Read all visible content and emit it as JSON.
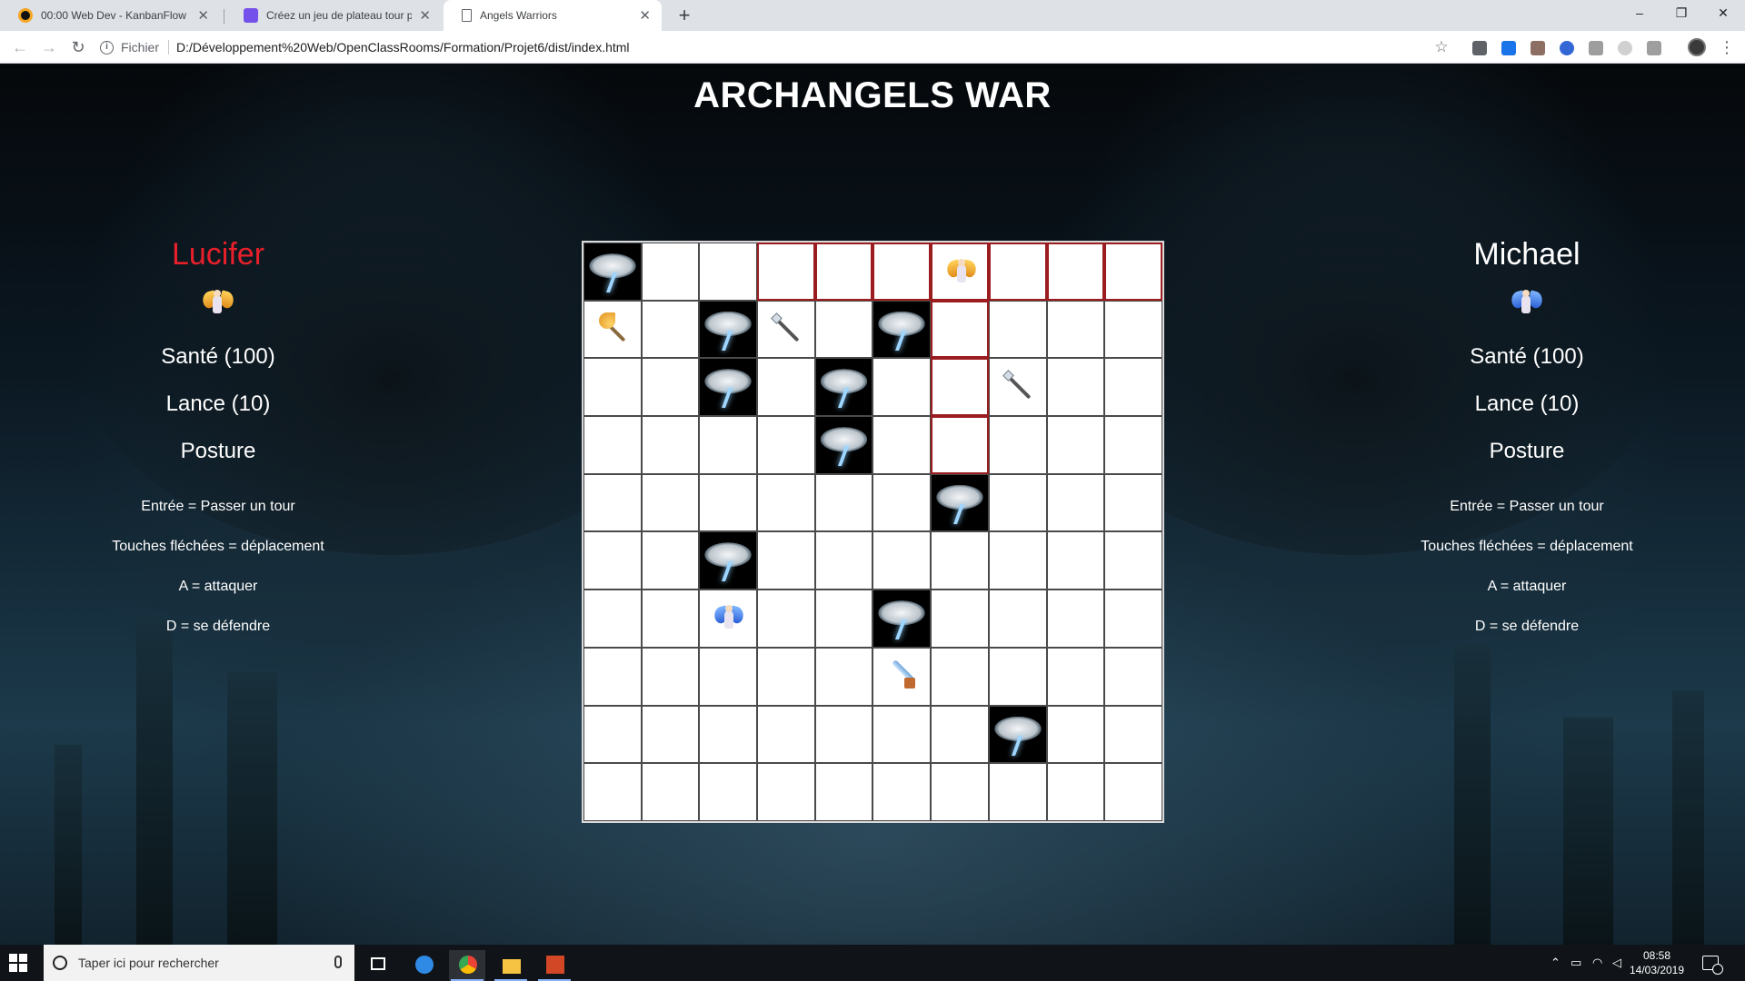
{
  "browser": {
    "tabs": [
      {
        "title": "00:00 Web Dev - KanbanFlow",
        "favicon_color": "#f5a623"
      },
      {
        "title": "Créez un jeu de plateau tour par",
        "favicon_color": "#7451eb"
      },
      {
        "title": "Angels Warriors",
        "favicon_color": "#ffffff"
      }
    ],
    "active_tab": 2,
    "address": {
      "scheme": "Fichier",
      "url": "D:/Développement%20Web/OpenClassRooms/Formation/Projet6/dist/index.html"
    }
  },
  "game": {
    "title": "ARCHANGELS WAR",
    "players": [
      {
        "name": "Lucifer",
        "name_color": "#e8202b",
        "avatar": "gold-angel-icon",
        "health": "Santé (100)",
        "weapon": "Lance (10)",
        "stance": "Posture",
        "controls": [
          "Entrée = Passer un tour",
          "Touches fléchées = déplacement",
          "A = attaquer",
          "D = se défendre"
        ]
      },
      {
        "name": "Michael",
        "name_color": "#ffffff",
        "avatar": "blue-angel-icon",
        "health": "Santé (100)",
        "weapon": "Lance (10)",
        "stance": "Posture",
        "controls": [
          "Entrée = Passer un tour",
          "Touches fléchées = déplacement",
          "A = attaquer",
          "D = se défendre"
        ]
      }
    ],
    "board": {
      "rows": 10,
      "cols": 10,
      "obstacles": [
        [
          0,
          0
        ],
        [
          1,
          2
        ],
        [
          1,
          5
        ],
        [
          2,
          2
        ],
        [
          2,
          4
        ],
        [
          3,
          4
        ],
        [
          4,
          6
        ],
        [
          5,
          2
        ],
        [
          6,
          5
        ],
        [
          8,
          7
        ]
      ],
      "highlights": [
        [
          0,
          3
        ],
        [
          0,
          4
        ],
        [
          0,
          5
        ],
        [
          0,
          6
        ],
        [
          0,
          7
        ],
        [
          0,
          8
        ],
        [
          0,
          9
        ],
        [
          1,
          6
        ],
        [
          2,
          6
        ],
        [
          3,
          6
        ]
      ],
      "pieces": [
        {
          "row": 0,
          "col": 6,
          "kind": "gold-angel-icon"
        },
        {
          "row": 6,
          "col": 2,
          "kind": "blue-angel-icon"
        },
        {
          "row": 1,
          "col": 0,
          "kind": "axe-icon"
        },
        {
          "row": 1,
          "col": 3,
          "kind": "spear-icon"
        },
        {
          "row": 2,
          "col": 7,
          "kind": "spear-icon"
        },
        {
          "row": 7,
          "col": 5,
          "kind": "sword-icon"
        }
      ]
    }
  },
  "taskbar": {
    "search_placeholder": "Taper ici pour rechercher",
    "time": "08:58",
    "date": "14/03/2019",
    "notification_count": "1"
  }
}
